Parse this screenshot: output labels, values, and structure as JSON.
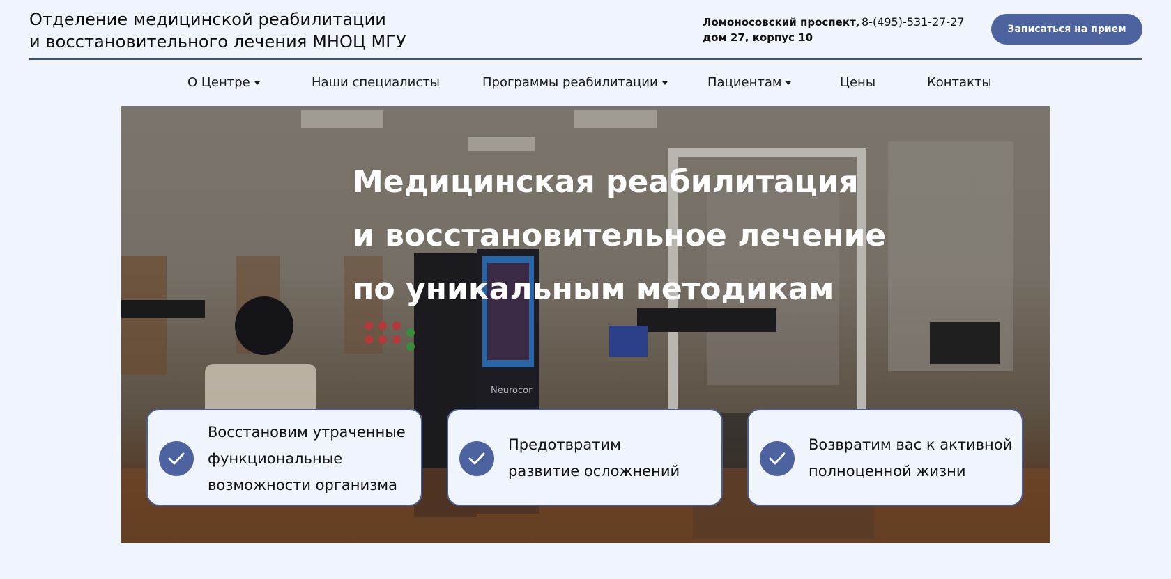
{
  "header": {
    "org_title_line1": "Отделение медицинской реабилитации",
    "org_title_line2": "и восстановительного лечения МНОЦ МГУ",
    "address_line1": "Ломоносовский проспект,",
    "address_line2": "дом 27, корпус 10",
    "phone": "8-(495)-531-27-27",
    "cta_label": "Записаться на прием"
  },
  "nav": {
    "items": [
      {
        "label": "О Центре",
        "has_dropdown": true
      },
      {
        "label": "Наши специалисты",
        "has_dropdown": false
      },
      {
        "label": "Программы реабилитации",
        "has_dropdown": true
      },
      {
        "label": "Пациентам",
        "has_dropdown": true
      },
      {
        "label": "Цены",
        "has_dropdown": false
      },
      {
        "label": "Контакты",
        "has_dropdown": false
      }
    ]
  },
  "hero": {
    "heading_line1": "Медицинская реабилитация",
    "heading_line2": "и восстановительное лечение",
    "heading_line3": "по уникальным методикам",
    "equipment_brand": "Neurocor",
    "features": [
      {
        "icon": "check-icon",
        "line1": "Восстановим утраченные",
        "line2": "функциональные",
        "line3": "возможности организма"
      },
      {
        "icon": "check-icon",
        "line1": "Предотвратим",
        "line2": "развитие осложнений"
      },
      {
        "icon": "check-icon",
        "line1": "Возвратим вас к активной",
        "line2": "полноценной жизни"
      }
    ]
  },
  "colors": {
    "page_background": "#f0f4fd",
    "accent": "#4d63a0",
    "divider": "#3d5276",
    "card_border": "#4a5d94"
  }
}
